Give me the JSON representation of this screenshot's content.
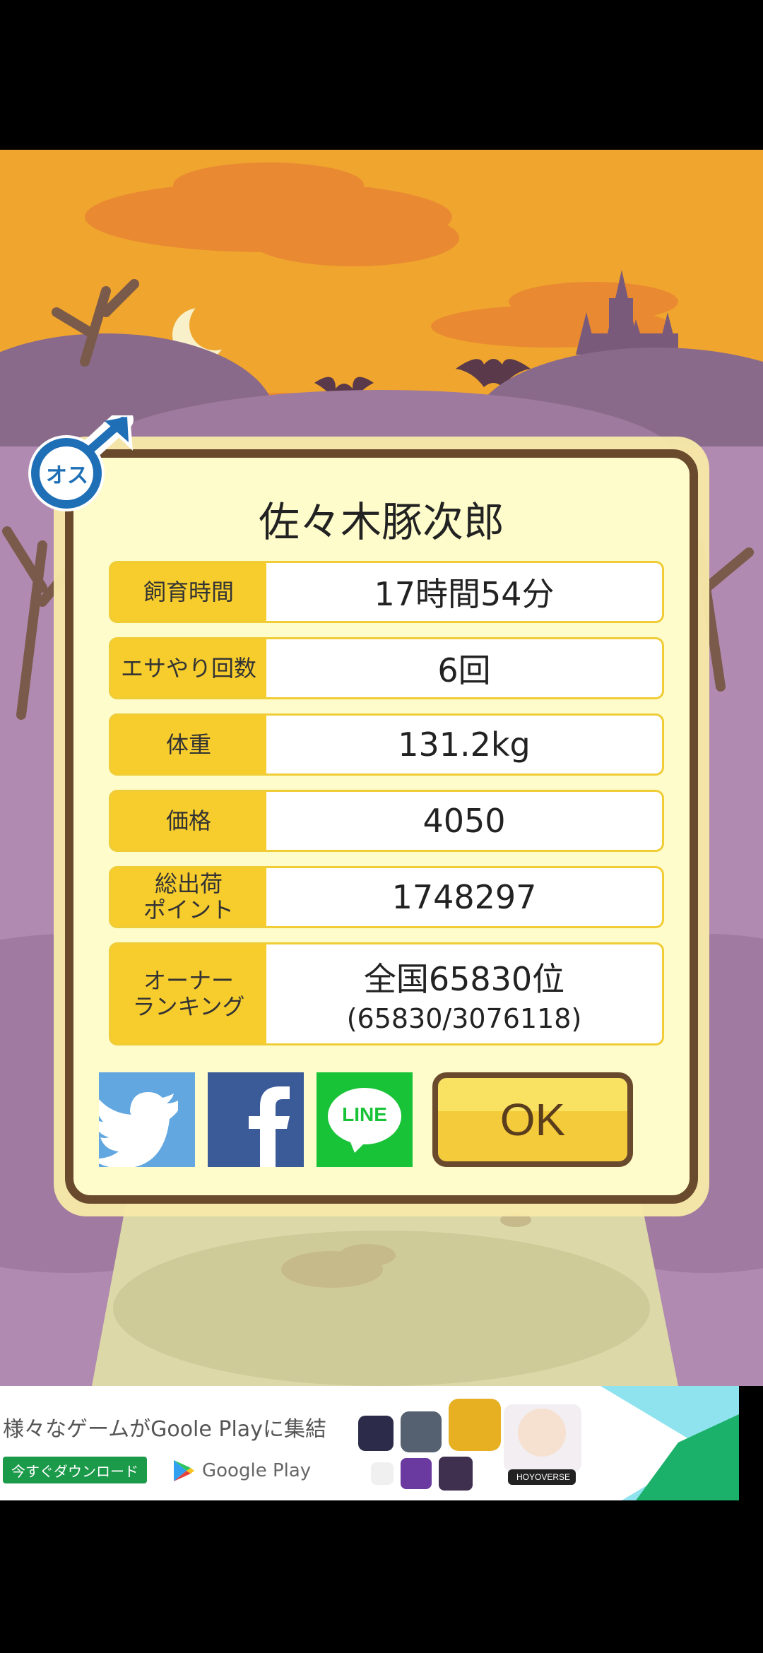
{
  "pig_name": "佐々木豚次郎",
  "gender_badge": "オス",
  "stats": [
    {
      "label": "飼育時間",
      "value": "17時間54分"
    },
    {
      "label": "エサやり回数",
      "value": "6回"
    },
    {
      "label": "体重",
      "value": "131.2kg"
    },
    {
      "label": "価格",
      "value": "4050"
    },
    {
      "label": "総出荷\nポイント",
      "value": "1748297"
    },
    {
      "label": "オーナー\nランキング",
      "value": "全国65830位",
      "sub": "(65830/3076118)"
    }
  ],
  "buttons": {
    "ok": "OK",
    "line": "LINE"
  },
  "ad": {
    "title": "様々なゲームがGoole Playに集結",
    "download": "今すぐダウンロード",
    "store": "Google Play",
    "hoyoverse": "HOYOVERSE"
  },
  "colors": {
    "sky": "#f0a52e",
    "frame": "#6a4a2c",
    "label_bg": "#f7cd2e",
    "twitter": "#62a7e0",
    "facebook": "#3a5a98",
    "line": "#19c338"
  }
}
